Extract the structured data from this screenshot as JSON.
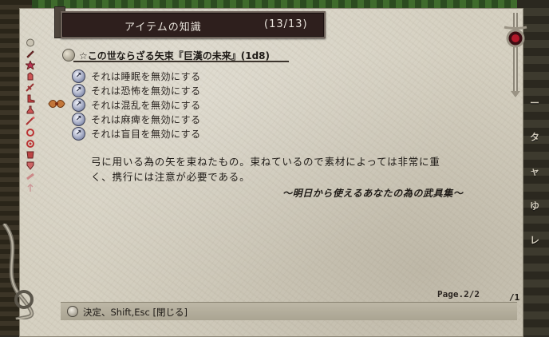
{
  "window": {
    "title": "アイテムの知識",
    "count": "(13/13)"
  },
  "item": {
    "heading": "☆この世ならざる矢束『巨漢の未来』(1d8)"
  },
  "enchantments": [
    {
      "icon": "enchant-orb-icon",
      "text": "それは睡眠を無効にする"
    },
    {
      "icon": "enchant-orb-icon",
      "text": "それは恐怖を無効にする"
    },
    {
      "icon": "enchant-orb-icon",
      "text": "それは混乱を無効にする"
    },
    {
      "icon": "enchant-orb-icon",
      "text": "それは麻痺を無効にする"
    },
    {
      "icon": "enchant-orb-icon",
      "text": "それは盲目を無効にする"
    }
  ],
  "description": {
    "lines": [
      "弓に用いる為の矢を束ねたもの。束ねているので素材によっては非常に重",
      "く、携行には注意が必要である。"
    ],
    "source": "～明日から使えるあなたの為の武具集～"
  },
  "pagination": {
    "page_label": "Page.2/2",
    "side_label": "/1"
  },
  "hint": {
    "text": "決定、Shift,Esc [閉じる]"
  },
  "side_tabs": [
    "ー",
    "タ",
    "ャ",
    "ゆ",
    "レ"
  ],
  "colors": {
    "parchment": "#d6d1c2",
    "title_bar": "#2e1f1d",
    "text": "#1f1b17",
    "accent_red": "#8b1a1a"
  }
}
